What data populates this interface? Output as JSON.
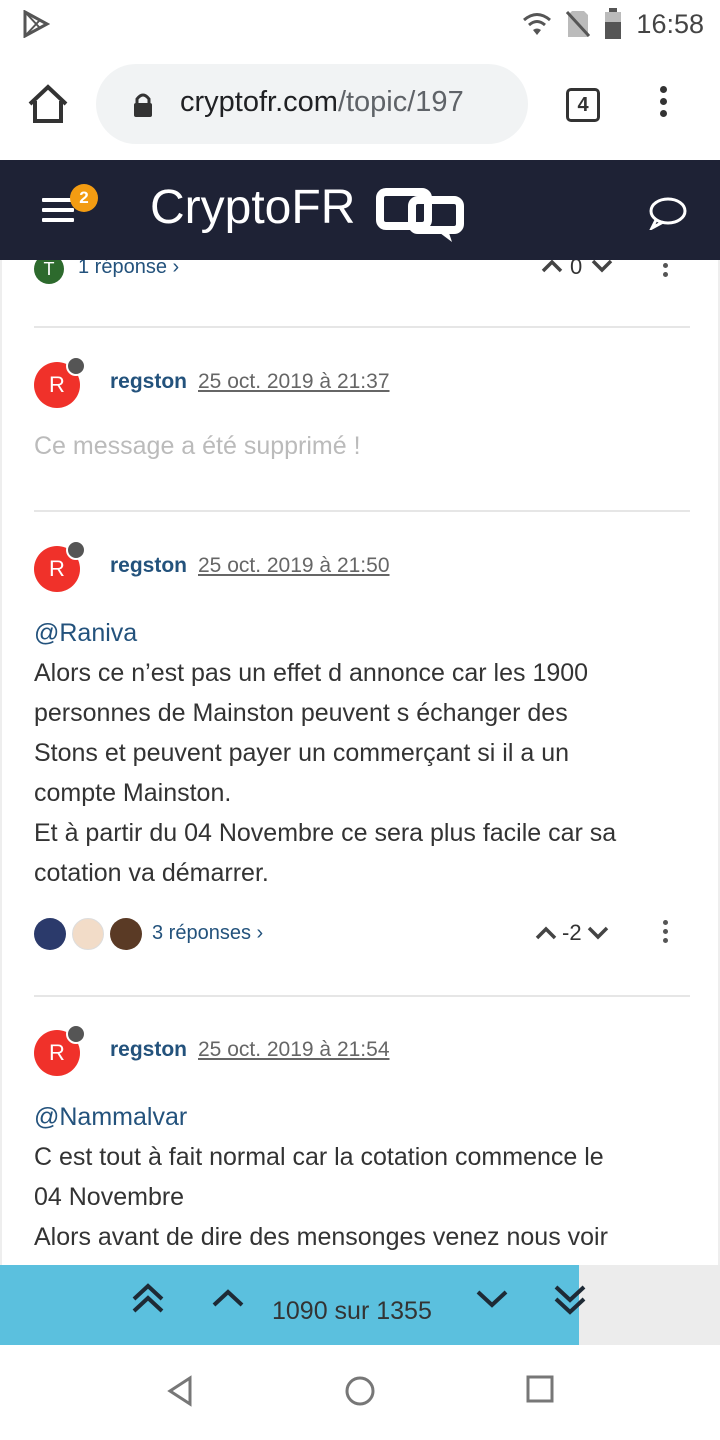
{
  "status_bar": {
    "time": "16:58",
    "icons": [
      "play-store-icon",
      "wifi-icon",
      "no-sim-icon",
      "battery-icon"
    ]
  },
  "browser": {
    "url_domain": "cryptofr.com",
    "url_path": "/topic/197",
    "tab_count": "4",
    "icons": [
      "home-icon",
      "lock-icon",
      "overflow-menu-icon"
    ]
  },
  "site": {
    "logo": "CryptoFR",
    "notifications": "2",
    "icons": [
      "hamburger-icon",
      "chat-icon"
    ]
  },
  "previous_post": {
    "avatar_letter": "T",
    "replies_label": "1 réponse",
    "votes": "0"
  },
  "posts": [
    {
      "avatar_letter": "R",
      "username": "regston",
      "timestamp": "25 oct. 2019 à 21:37",
      "deleted_text": "Ce message a été supprimé !"
    },
    {
      "avatar_letter": "R",
      "username": "regston",
      "timestamp": "25 oct. 2019 à 21:50",
      "mention": "@Raniva",
      "lines": [
        "Alors ce n’est pas un effet d annonce car les 1900",
        "personnes de Mainston peuvent s échanger des",
        "Stons et peuvent payer un commerçant si il a un",
        "compte Mainston.",
        "Et à partir du 04 Novembre ce sera plus facile car sa",
        "cotation va démarrer."
      ],
      "replies_label": "3 réponses",
      "votes": "-2"
    },
    {
      "avatar_letter": "R",
      "username": "regston",
      "timestamp": "25 oct. 2019 à 21:54",
      "mention": "@Nammalvar",
      "lines": [
        "C est tout à fait normal car la cotation commence le",
        "04 Novembre",
        "Alors avant de dire des mensonges venez nous voir"
      ]
    }
  ],
  "pager": {
    "label": "1090 sur 1355",
    "progress": 0.804,
    "colors": {
      "fill": "#5bc0de",
      "track": "#ececec"
    }
  },
  "colors": {
    "header_bg": "#1e2235",
    "link": "#23527c",
    "avatar": "#f0312a",
    "badge": "#f39c12"
  }
}
